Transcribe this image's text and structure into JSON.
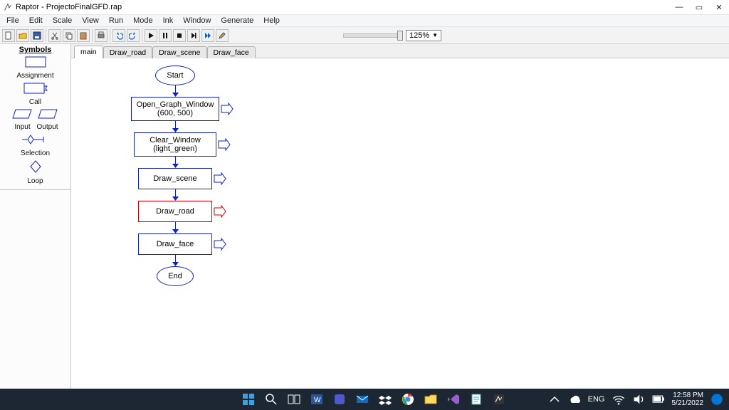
{
  "title": "Raptor - ProjectoFinalGFD.rap",
  "menu": [
    "File",
    "Edit",
    "Scale",
    "View",
    "Run",
    "Mode",
    "Ink",
    "Window",
    "Generate",
    "Help"
  ],
  "zoom": "125%",
  "symbols": {
    "heading": "Symbols",
    "assignment": "Assignment",
    "call": "Call",
    "input": "Input",
    "output": "Output",
    "selection": "Selection",
    "loop": "Loop"
  },
  "tabs": [
    "main",
    "Draw_road",
    "Draw_scene",
    "Draw_face"
  ],
  "active_tab": 0,
  "flow": {
    "start": "Start",
    "n1l1": "Open_Graph_Window",
    "n1l2": "(600, 500)",
    "n2l1": "Clear_Window",
    "n2l2": "(light_green)",
    "n3": "Draw_scene",
    "n4": "Draw_road",
    "n5": "Draw_face",
    "end": "End"
  },
  "tray": {
    "lang": "ENG",
    "time": "12:58 PM",
    "date": "5/21/2022"
  }
}
